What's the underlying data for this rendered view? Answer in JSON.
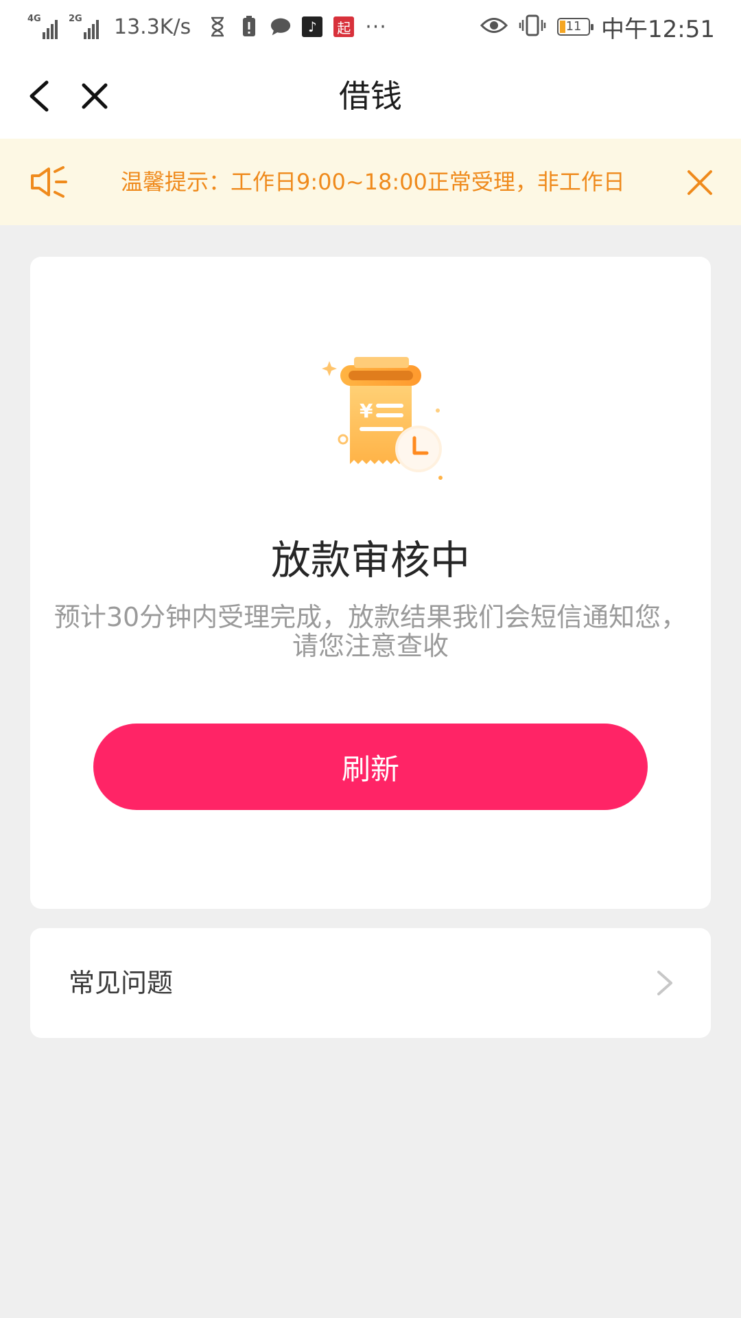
{
  "status_bar": {
    "network_1": "4G",
    "network_2": "2G",
    "speed": "13.3K/s",
    "overflow": "···",
    "battery_level": "11",
    "time": "中午12:51",
    "icons": [
      "signal-icon",
      "hourglass-icon",
      "alert-icon",
      "chat-bubble-icon",
      "tiktok-icon",
      "app-qi-icon",
      "eye-icon",
      "vibrate-icon",
      "battery-icon"
    ],
    "notification_app_label": "起"
  },
  "nav": {
    "title": "借钱"
  },
  "notice": {
    "text": "温馨提示：工作日9:00~18:00正常受理，非工作日",
    "color": "#ef8a1c",
    "background": "#fdf8e4"
  },
  "status_card": {
    "title": "放款审核中",
    "description": "预计30分钟内受理完成，放款结果我们会短信通知您，请您注意查收",
    "refresh_label": "刷新",
    "button_color": "#ff2466"
  },
  "faq": {
    "label": "常见问题"
  }
}
